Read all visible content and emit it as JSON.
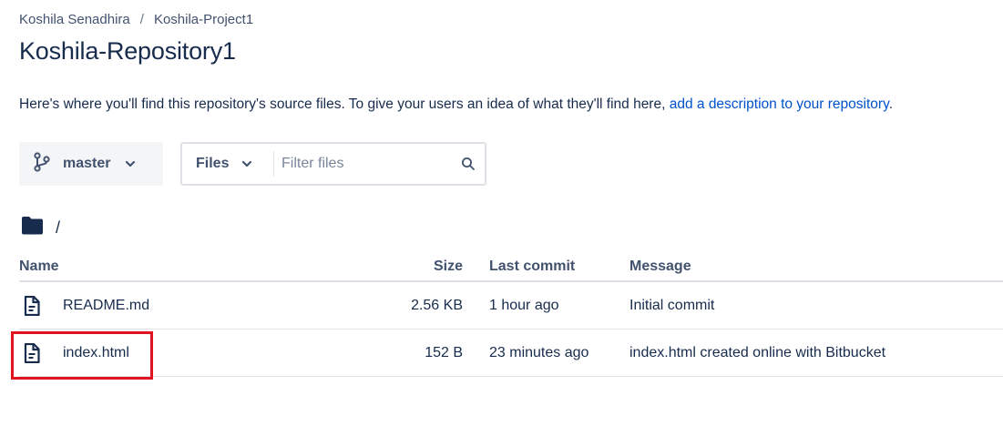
{
  "breadcrumb": {
    "owner": "Koshila Senadhira",
    "separator": "/",
    "project": "Koshila-Project1"
  },
  "repo": {
    "title": "Koshila-Repository1"
  },
  "description": {
    "text": "Here's where you'll find this repository's source files. To give your users an idea of what they'll find here, ",
    "link": "add a description to your repository",
    "suffix": "."
  },
  "toolbar": {
    "branch": "master",
    "files_select": "Files",
    "filter_placeholder": "Filter files"
  },
  "path": {
    "current": "/"
  },
  "table": {
    "headers": {
      "name": "Name",
      "size": "Size",
      "last_commit": "Last commit",
      "message": "Message"
    },
    "rows": [
      {
        "name": "README.md",
        "size": "2.56 KB",
        "last_commit": "1 hour ago",
        "message": "Initial commit"
      },
      {
        "name": "index.html",
        "size": "152 B",
        "last_commit": "23 minutes ago",
        "message": "index.html created online with Bitbucket"
      }
    ]
  },
  "highlight": {
    "color": "#e0131f"
  },
  "colors": {
    "text": "#172b4d",
    "subtle": "#42526e",
    "link": "#0052cc",
    "border": "#dfe1e6"
  },
  "icons": {
    "branch": "branch-icon",
    "chevron": "chevron-down-icon",
    "search": "search-icon",
    "folder": "folder-icon",
    "file": "file-icon"
  }
}
